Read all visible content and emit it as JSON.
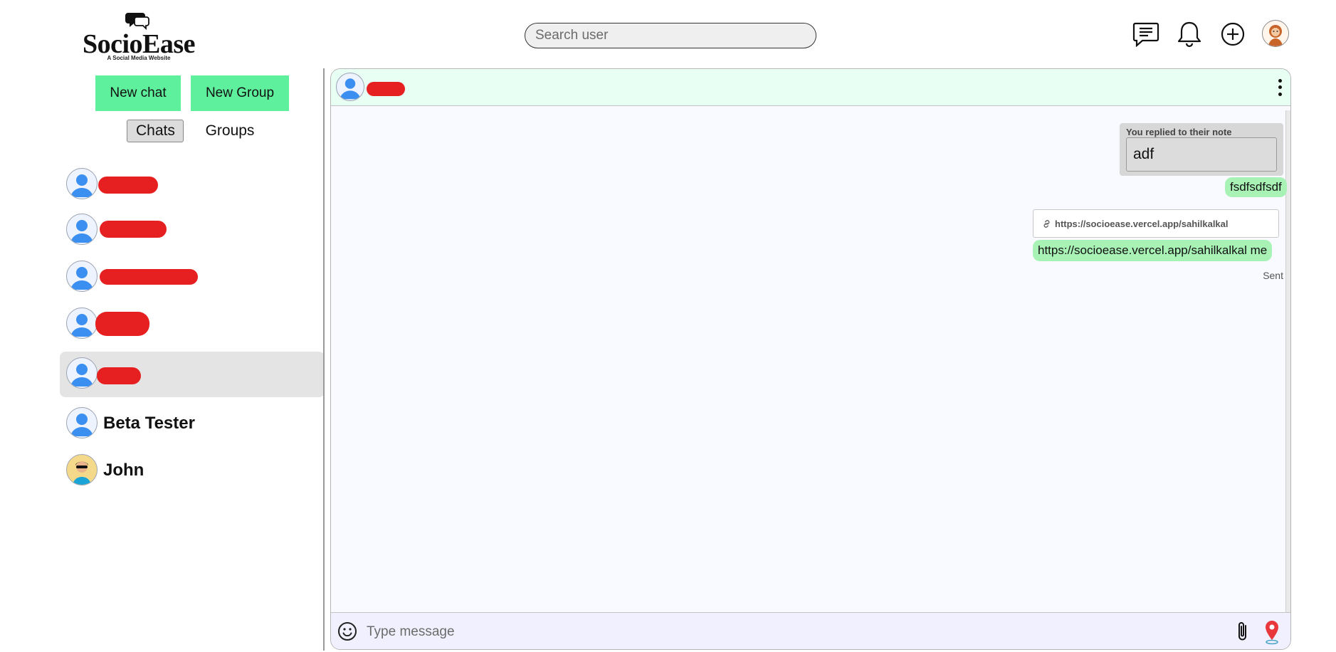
{
  "header": {
    "logo_text": "SocioEase",
    "logo_tagline": "A Social Media Website",
    "search_placeholder": "Search user",
    "icons": [
      "messages-icon",
      "bell-icon",
      "plus-circle-icon",
      "profile-avatar"
    ]
  },
  "sidebar": {
    "new_chat_label": "New chat",
    "new_group_label": "New Group",
    "tabs": [
      {
        "label": "Chats",
        "active": true
      },
      {
        "label": "Groups",
        "active": false
      }
    ],
    "chats": [
      {
        "name": "",
        "redacted": true
      },
      {
        "name": "",
        "redacted": true
      },
      {
        "name": "",
        "redacted": true
      },
      {
        "name": "",
        "redacted": true
      },
      {
        "name": "",
        "redacted": true,
        "selected": true
      },
      {
        "name": "Beta Tester",
        "redacted": false
      },
      {
        "name": "John",
        "redacted": false
      }
    ]
  },
  "chat": {
    "contact_name": "",
    "messages": [
      {
        "type": "reply",
        "reply_label": "You replied to their note",
        "quoted_text": "adf",
        "text": "fsdfsdfsdf"
      },
      {
        "type": "link",
        "preview_url": "https://socioease.vercel.app/sahilkalkal",
        "text": "https://socioease.vercel.app/sahilkalkal me"
      }
    ],
    "status": "Sent",
    "composer_placeholder": "Type message"
  },
  "colors": {
    "accent_green": "#5ef09c",
    "bubble_green": "#a8f2b6",
    "chat_header_bg": "#e8fff4",
    "composer_bg": "#f1f0ff",
    "redaction_red": "#e62020"
  }
}
